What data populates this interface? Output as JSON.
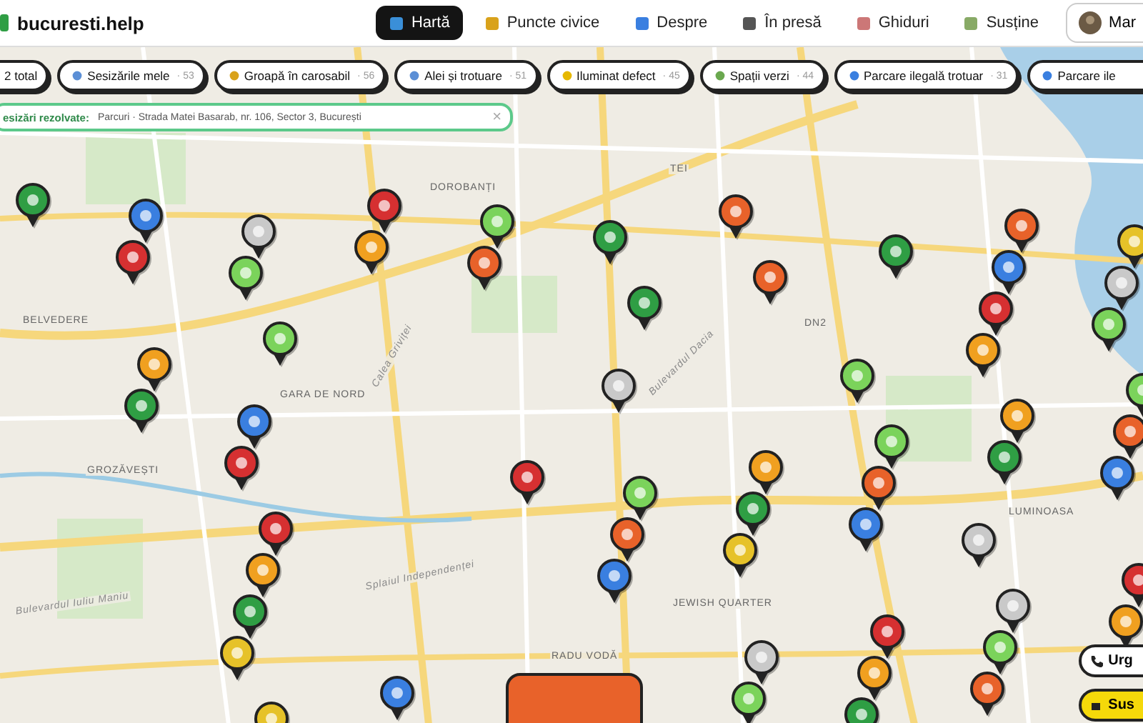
{
  "header": {
    "logo": "bucuresti.help",
    "nav": [
      {
        "label": "Hartă",
        "selected": true
      },
      {
        "label": "Puncte civice",
        "selected": false
      },
      {
        "label": "Despre",
        "selected": false
      },
      {
        "label": "În presă",
        "selected": false
      },
      {
        "label": "Ghiduri",
        "selected": false
      },
      {
        "label": "Susține",
        "selected": false
      }
    ],
    "user_button": "Mar"
  },
  "total_chip": "2 total",
  "filters": [
    {
      "label": "Sesizările mele",
      "count": "· 53"
    },
    {
      "label": "Groapă în carosabil",
      "count": "· 56"
    },
    {
      "label": "Alei și trotuare",
      "count": "· 51"
    },
    {
      "label": "Iluminat defect",
      "count": "· 45"
    },
    {
      "label": "Spații verzi",
      "count": "· 44"
    },
    {
      "label": "Parcare ilegală trotuar",
      "count": "· 31"
    },
    {
      "label": "Parcare ile"
    }
  ],
  "resolved_bar": {
    "prefix": "esizări rezolvate:",
    "text": "Parcuri · Strada Matei Basarab, nr. 106, Sector 3, București",
    "clear": "×"
  },
  "map": {
    "labels": [
      "DOROBANȚI",
      "BELVEDERE",
      "GARA DE NORD",
      "GROZĂVEȘTI",
      "TEI",
      "LUMINOASA",
      "RADU VODĂ",
      "JEWISH QUARTER",
      "Calea Griviței",
      "Bulevardul Dacia",
      "Splaiul Independenței",
      "Bulevardul Iuliu Maniu",
      "DN2"
    ]
  },
  "side_buttons": [
    {
      "label": "Urg",
      "kind": "call"
    },
    {
      "label": "Sus",
      "kind": "support"
    }
  ]
}
